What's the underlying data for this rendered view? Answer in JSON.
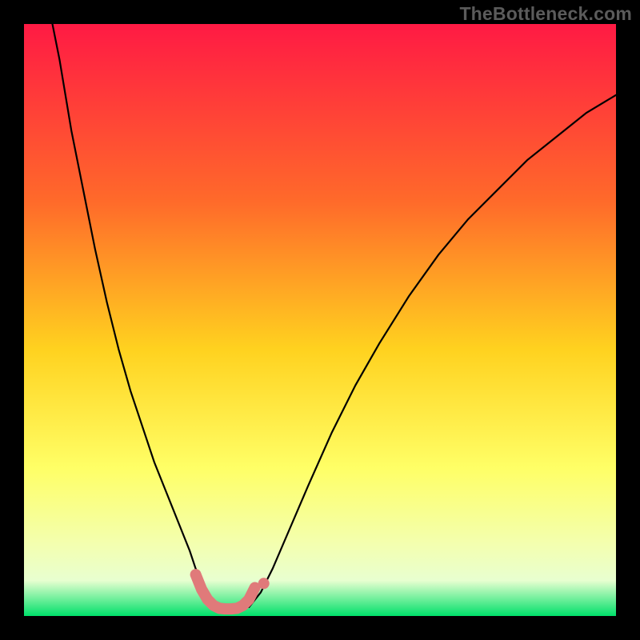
{
  "watermark": "TheBottleneck.com",
  "colors": {
    "frame": "#000000",
    "gradient_top": "#ff1a44",
    "gradient_mid1": "#ff6a2a",
    "gradient_mid2": "#ffd21f",
    "gradient_mid3": "#ffff66",
    "gradient_mid4": "#f3ffb0",
    "gradient_bottom_band": "#e8ffd0",
    "gradient_bottom": "#00e06a",
    "curve": "#000000",
    "highlight": "#e07a7a"
  },
  "chart_data": {
    "type": "line",
    "title": "",
    "xlabel": "",
    "ylabel": "",
    "xlim": [
      0,
      100
    ],
    "ylim": [
      0,
      100
    ],
    "series": [
      {
        "name": "left-curve",
        "x": [
          4,
          6,
          8,
          10,
          12,
          14,
          16,
          18,
          20,
          22,
          24,
          26,
          28,
          29,
          30,
          31,
          32,
          33
        ],
        "y": [
          104,
          94,
          82,
          72,
          62,
          53,
          45,
          38,
          32,
          26,
          21,
          16,
          11,
          8,
          6,
          4,
          2.5,
          1.5
        ]
      },
      {
        "name": "right-curve",
        "x": [
          38,
          40,
          42,
          45,
          48,
          52,
          56,
          60,
          65,
          70,
          75,
          80,
          85,
          90,
          95,
          100
        ],
        "y": [
          1.5,
          4,
          8,
          15,
          22,
          31,
          39,
          46,
          54,
          61,
          67,
          72,
          77,
          81,
          85,
          88
        ]
      },
      {
        "name": "valley-highlight",
        "x": [
          29,
          30,
          31,
          32,
          33,
          34,
          35,
          36,
          37,
          38,
          39
        ],
        "y": [
          7,
          4.5,
          2.8,
          1.8,
          1.3,
          1.2,
          1.2,
          1.3,
          1.8,
          2.8,
          4.8
        ]
      }
    ],
    "annotations": [
      {
        "name": "dot-above-valley",
        "x": 40.5,
        "y": 5.5
      }
    ]
  }
}
